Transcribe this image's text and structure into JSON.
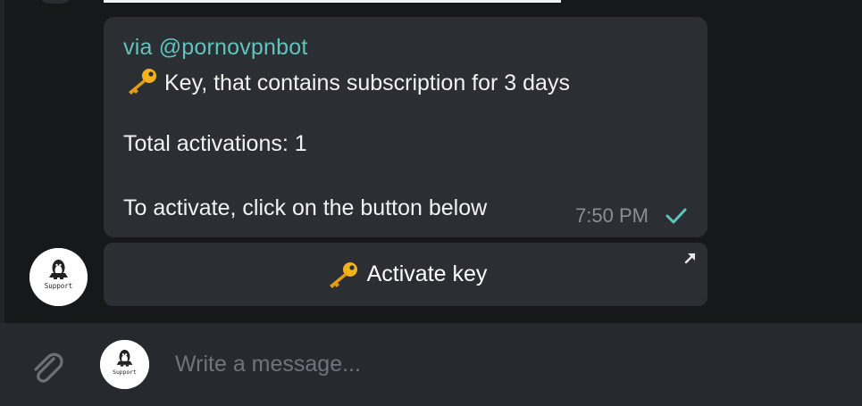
{
  "message": {
    "via": "via @pornovpnbot",
    "line1": "Key, that contains subscription for 3 days",
    "line2": "Total activations: 1",
    "line3": "To activate, click on the button below",
    "time": "7:50 PM",
    "status": "sent"
  },
  "inline_button": {
    "label": "Activate key",
    "icon": "arrow-up-right-icon"
  },
  "avatar": {
    "label": "Support"
  },
  "input": {
    "placeholder": "Write a message..."
  },
  "colors": {
    "background": "#17181a",
    "bubble": "#2b2e33",
    "via_link": "#5fc4bd",
    "check": "#5fc4bd",
    "input_bar": "#262a2f"
  },
  "icons": {
    "emoji": "key-icon",
    "attach": "paperclip-icon",
    "read_status": "check-icon"
  }
}
